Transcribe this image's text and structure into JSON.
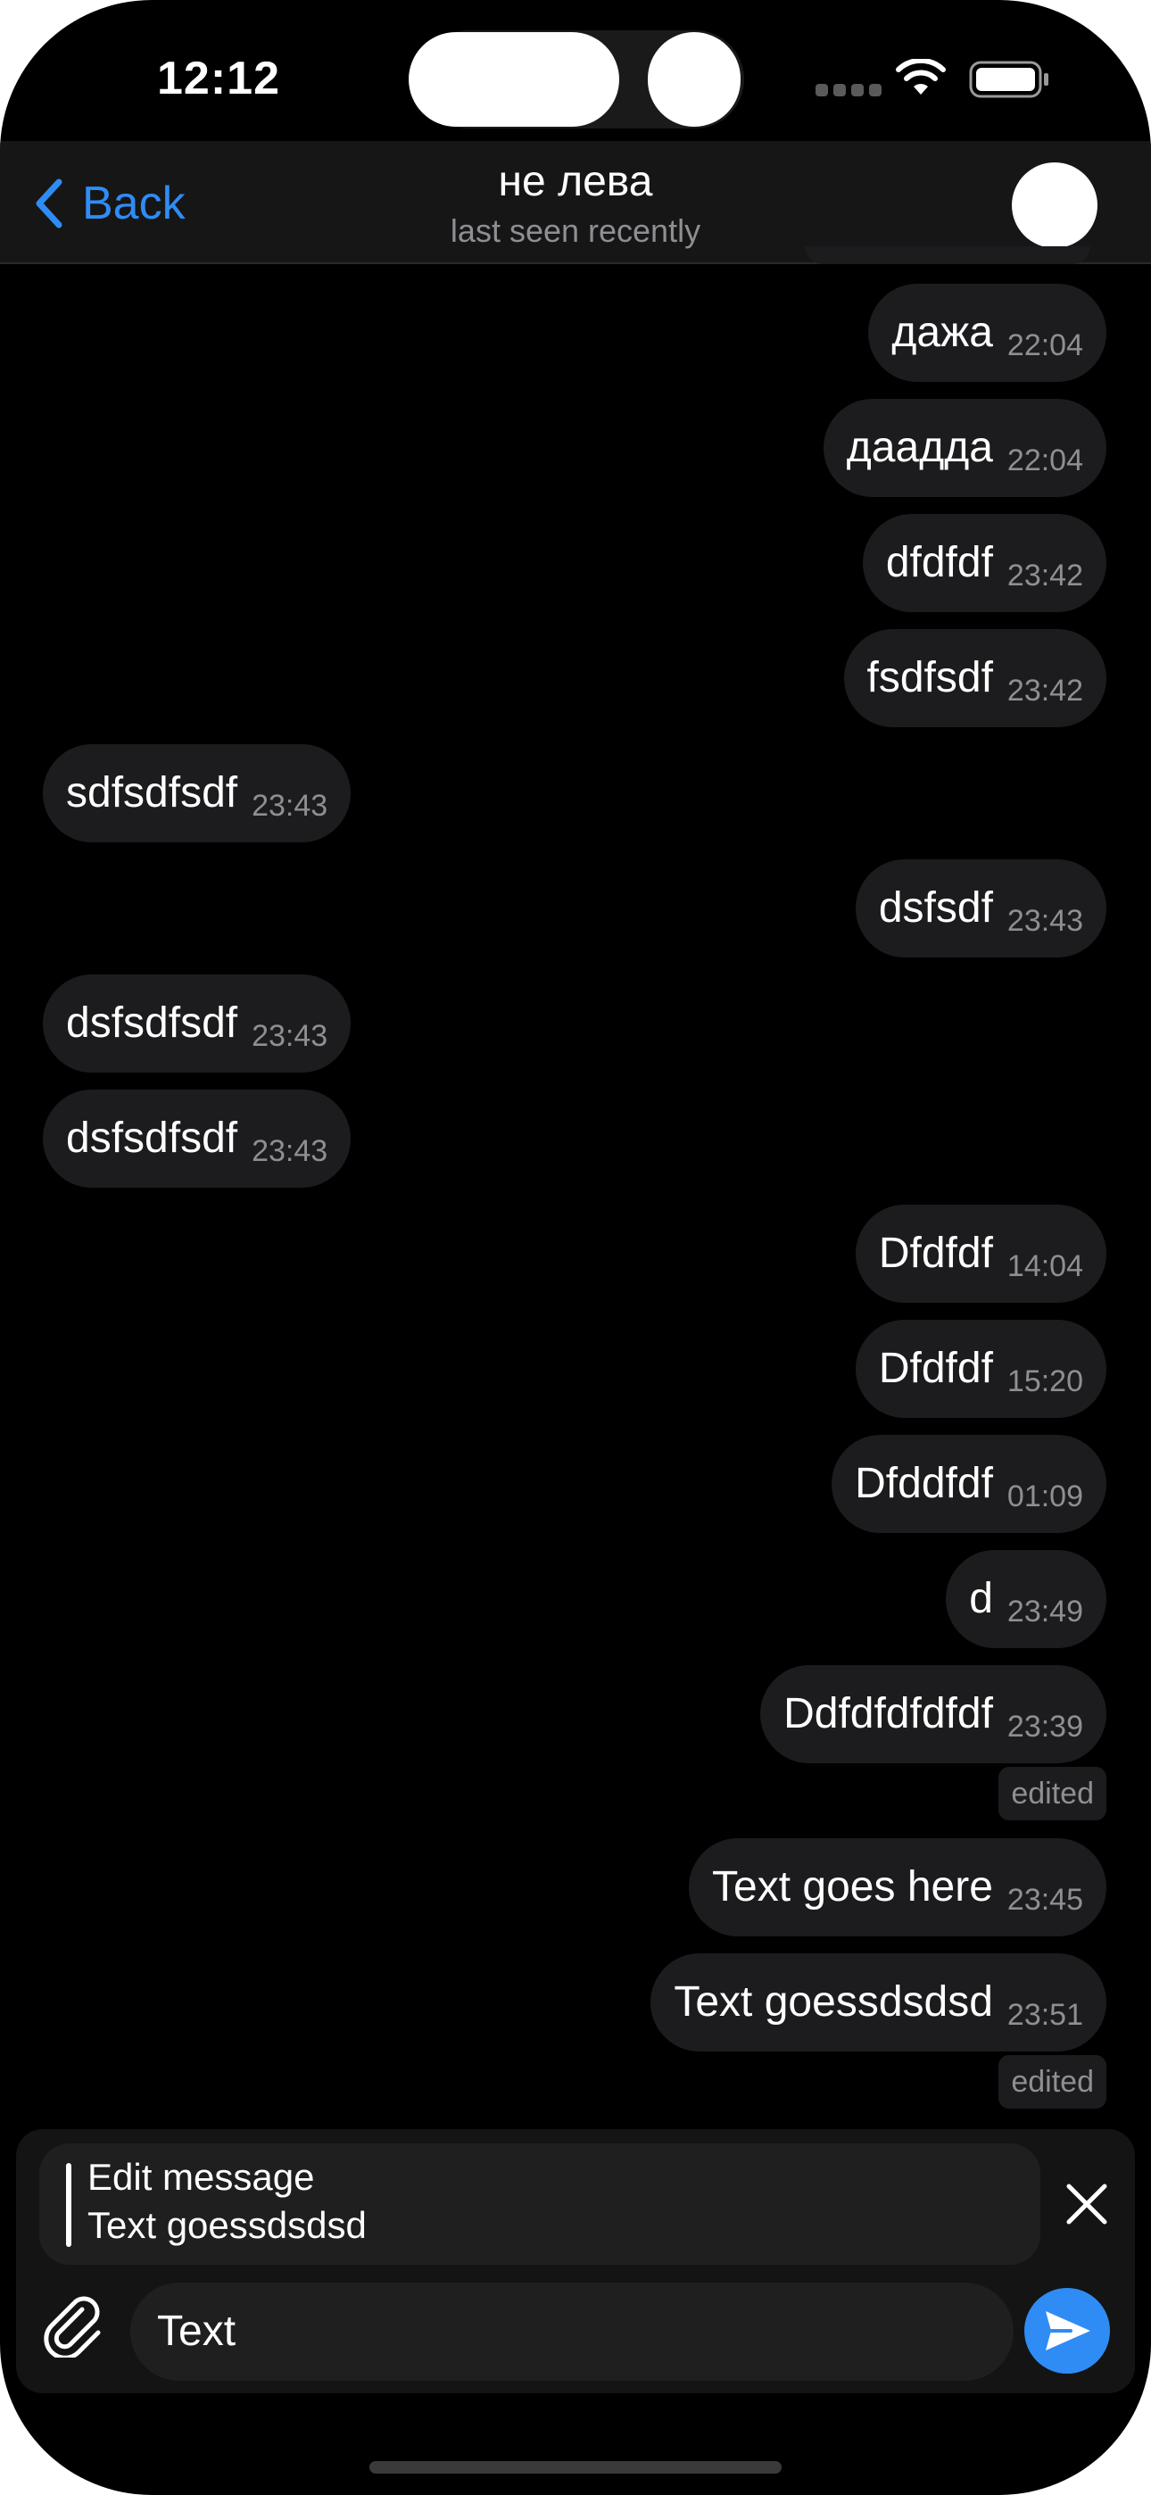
{
  "status_bar": {
    "time": "12:12"
  },
  "header": {
    "back_label": "Back",
    "title": "не лева",
    "subtitle": "last seen recently"
  },
  "messages": [
    {
      "text": "дажа",
      "time": "22:04",
      "side": "out"
    },
    {
      "text": "даадда",
      "time": "22:04",
      "side": "out"
    },
    {
      "text": "dfdfdf",
      "time": "23:42",
      "side": "out"
    },
    {
      "text": "fsdfsdf",
      "time": "23:42",
      "side": "out"
    },
    {
      "text": "sdfsdfsdf",
      "time": "23:43",
      "side": "in"
    },
    {
      "text": "dsfsdf",
      "time": "23:43",
      "side": "out"
    },
    {
      "text": "dsfsdfsdf",
      "time": "23:43",
      "side": "in"
    },
    {
      "text": "dsfsdfsdf",
      "time": "23:43",
      "side": "in"
    },
    {
      "text": "Dfdfdf",
      "time": "14:04",
      "side": "out"
    },
    {
      "text": "Dfdfdf",
      "time": "15:20",
      "side": "out"
    },
    {
      "text": "Dfddfdf",
      "time": "01:09",
      "side": "out"
    },
    {
      "text": "d",
      "time": "23:49",
      "side": "out"
    },
    {
      "text": "Ddfdfdfdfdf",
      "time": "23:39",
      "side": "out",
      "edited": "edited"
    },
    {
      "text": "Text goes here",
      "time": "23:45",
      "side": "out"
    },
    {
      "text": "Text goessdsdsd",
      "time": "23:51",
      "side": "out",
      "edited": "edited"
    }
  ],
  "composer": {
    "edit_title": "Edit message",
    "edit_text": "Text goessdsdsd",
    "input_value": "Text"
  },
  "colors": {
    "accent": "#2f8cf5",
    "background": "#000000",
    "bubble": "#1c1c1e",
    "secondary_text": "#8e8e93"
  },
  "icons": {
    "back": "chevron-left-icon",
    "close": "close-icon",
    "attach": "paperclip-icon",
    "send": "send-icon"
  }
}
